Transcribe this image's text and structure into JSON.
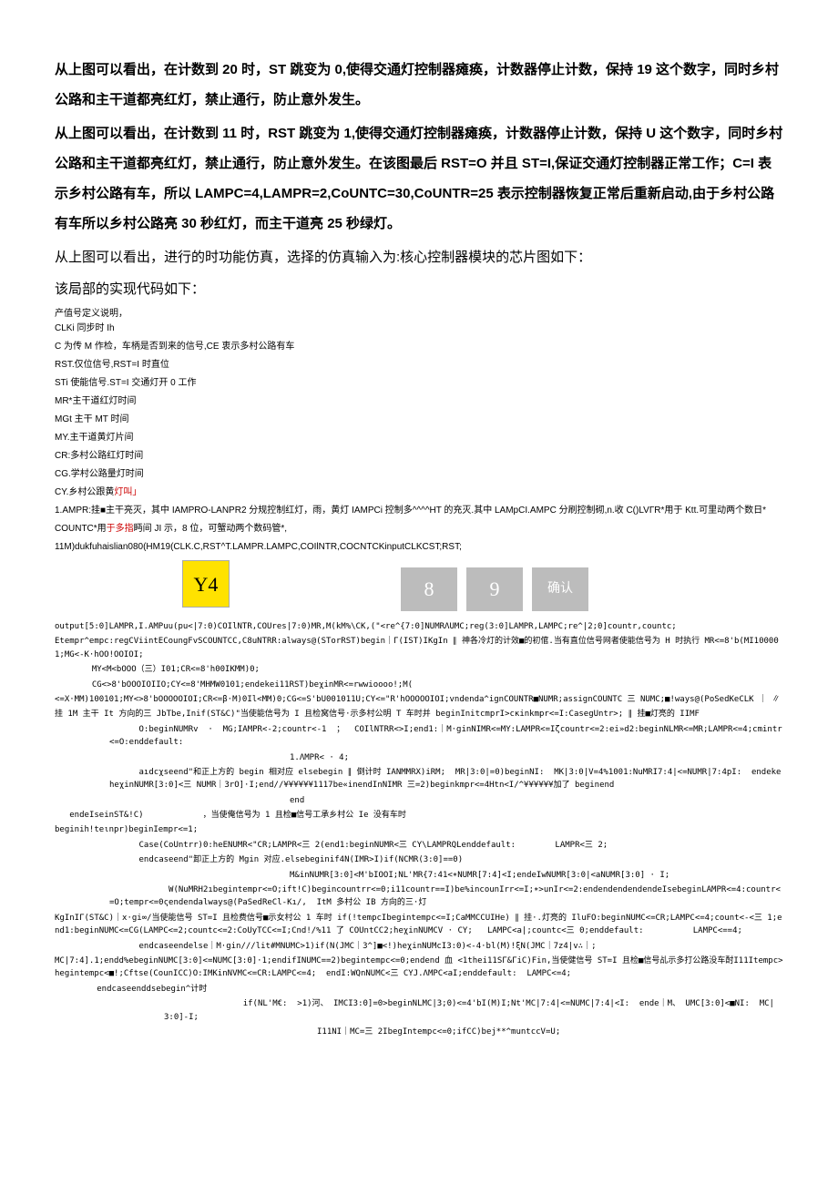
{
  "p1": "从上图可以看出，在计数到 20 时，ST 跳变为 0,使得交通灯控制器瘫痪，计数器停止计数，保持 19 这个数字，同时乡村公路和主干道都亮红灯，禁止通行，防止意外发生。",
  "p2": "从上图可以看出，在计数到 11 时，RST 跳变为 1,使得交通灯控制器瘫痪，计数器停止计数，保持 U 这个数字，同时乡村公路和主干道都亮红灯，禁止通行，防止意外发生。在该图最后 RST=O 并且 ST=I,保证交通灯控制器正常工作；C=I 表示乡村公路有车，所以 LAMPC=4,LAMPR=2,CoUNTC=30,CoUNTR=25 表示控制器恢复正常后重新启动,由于乡村公路有车所以乡村公路亮 30 秒红灯，而主干道亮 25 秒绿灯。",
  "p3": "从上图可以看出，进行的时功能仿真，选择的仿真输入为:核心控制器模块的芯片图如下：",
  "p4": "该局部的实现代码如下：",
  "s1a": "产值号定义说明，",
  "s1b": "CLKi 同步时 Ih",
  "s2": "C 为传 M 作检，车柄是否到来的信号,CE 衷示多村公路有车",
  "s3": "RST.仅位信号,RST=I 时直位",
  "s4": "STi 使能信号.ST=I 交通灯开 0 工作",
  "s5": "MR*主干道红灯时间",
  "s6": "MGt 主干 MT 时间",
  "s7": "MY.主干道黄灯片间",
  "s8": "CR:多村公路红灯时间",
  "s9": "CG.学村公路量灯时间",
  "s10a": "CY.乡村公跟黄",
  "s10b": "灯叫」",
  "s11": "1.AMPR:挂■主干亮灭，其中 IAMPRO-LANPR2 分规控制红灯，雨，黄灯 IAMPCi 控制多^^^^HT 的充灭.其中 LAMpCI.AMPC 分刷控制砌,n.收 C()LVГR*用于 Ktt.可里动两个数日*",
  "s12a": "COUNTC*用",
  "s12b": "于多指",
  "s12c": "眄间 JI 示，8 位，可蟹动两个数码管*,",
  "s13": "11M)dukfuhaislian080(HM19(CLK.C,RST^T.LAMPR.LAMPC,COIlNTR,COCNTCKinputCLKCST;RST;",
  "yellow": "Y4",
  "btn1": "8",
  "btn2": "9",
  "btn3": "确认",
  "c1": "output[5:0]LAMPR,I.AMPuu(pu<|7:0)COIlNTR,COUres|7:0)MR,M(kM%\\CK,(\"<re^{7:0]NUMRΛUMC;reg(3:0]LAMPR,LAMPC;re^|2;0]countr,countc;",
  "c2": "Etempr^empc:regCViintECoungFvSCOUNTCC,C8uNTRR:always@(STorRST)begin｜Γ(IST)IKgIn ∥ 神各冷灯的计效■的初倌.当有直位信号网者使能信号为 H 时执行 MR<=8'b(MI100001;MG<-K·hOO!OOIOI;",
  "c3": "  MY<M<bOOO（三）I01;CR<=8'h00IKMM)0;",
  "c4": "  CG<>8'bOOOIOIIO;CY<=8'MHMW0101;endekei11RST)beχinMR<=rwwioooo!;M(",
  "c5": "<=X·MM)100101;MY<>8'bOOOOOIOI;CR<=β·M)0Il<MM)0;CG<=S'bU001011U;CY<=\"R'hOOOOOIOI;vndenda^ignCOUNTR■NUMR;assignCOUNTC 三 NUMC;■!ways@(PoSedKeCLK ｜ ∥",
  "c6": "挂 1M 主干 It 方向的三 JbTbe,Inif(ST&C)\"当使能信号为 I 且检窝信号·示多村公明 T 车时并 beginInitcmprI>cκinkmpr<=I:CasegUntr>; ∥ 挂■灯亮的 IIMF",
  "c7": "      O:beginNUMRv  ·  MG;IAMPR<-2;countr<-1  ；  COIlNTRR<>I;end1:｜M·ginNIMR<=MY:LAMPR<=Iζcountr<=2:ei»d2:beginNLMR<=MR;LAMPR<=4;cmintr<=O:enddefault:",
  "c8": "                               1.ΛMPR< · 4;",
  "c9": "      aıdcχseend\"和正上方的 begin 相对应 elsebegin ∥ 倒计时 IANMMRX)iRM;  MR|3:0|=0)beginNI:  MK|3:0|V=4%1001:NuMRI7:4|<=NUMR|7:4pI:  endekeheχinNUMR[3:0]<三 NUMR｜3rO]·I;end//¥¥¥¥¥¥1117be«inendInNIMR 三=2)beginkmpr<=4Htn<I/^¥¥¥¥¥¥加了 beginend",
  "c9b": "                               end",
  "c10": "   endeIseinST&!C)            ，当使俺信号为 1 且检■信号工承乡村公 Ie 没有车时",
  "c11": "beginih!teιnpr)beginIempr<=1;",
  "c12": "      Case(CoUntrr)0:heENUMR<\"CR;LAMPR<三 2(end1:beginNUMR<三 CY\\LAMPRQLenddefault:        LAMPR<三 2;",
  "c13": "      endcaseend\"卸正上方的 Mgin 对应.elsebeginif4N(IMR>I)if(NCMR(3:0]==0)",
  "c14": "                               M&inNUMR[3:0]<M'bIOOI;NL'MR{7:41<∗NUMR[7:4]<I;endeIwNUMR[3:0|<aNUMR[3:0] · I;",
  "c15": "            W(NuMRH2ıbegintempr<=O;ift!C)begincountrr<=0;i11countr==I)be%incounIrr<=I;∗>unIr<=2:endendendendendeIsebeginLAMPR<=4:countr<=O;tempr<=0ςendendalways@(PaSedReCl-Kı/,  ItM 多村公 IB 方向的三·灯",
  "c16": "KgInIΓ(ST&C)｜x·gi∞/当使能信号 ST=I 且检费信号■示女村公 1 车时 if(!tempcIbegintempc<=I;CaMMCCUIHe) ∥ 挂·.灯亮的 IluFO:beginNUMC<=CR;LAMPC<=4;count<-<三 1;end1:beginNUMC<=CG(LAMPC<=2;countc<=2:CoUyTCC<=I;Cnd!/%11 了 COUntCC2;heχinNUMCV · CY;   LAMPC<a|;countc<三 0;enddefault:          LAMPC<==4;",
  "c17": "      endcaseendelse｜M·gin///lit#MNUMC>1)if(N(JMC｜3^]■<!)heχinNUMcI3:0)<-4·bl(M)!ξN(JMC｜7z4|v∴｜;",
  "c18": "MC|7:4].1;endd%ebeginNUMC[3:0]<=NUMC[3:0]·1;endifINUMC==2)begintempc<=0;endend 血 <1thei11SΓ&ΓiC)Fin,当使健信号 ST=I 且检■信号乩示多打公路没车酎I11Itempc>hegintempc<■!;Cftse(CounICC)O:IMKinNVMC<=CR:LAMPC<=4;  endI:WQnNUMC<三 CYJ.ΛMPC<aI;enddefault:  LAMPC<=4;",
  "c19": "   endcaseenddsebegin^计时",
  "c20": "                if(NL'M€:  >1)河、 IMCI3:0]=0>beginNLMC|3;0)<=4'bI(M)I;Nt'MC|7:4|<=NUMC|7:4|<I:  ende｜M、 UMC[3:0]<■NI:  MC|3:0]-I;",
  "c21": "                               I11NI｜MC=三 2IbegIntempc<=0;ifCC)bej**^muntccV=U;"
}
